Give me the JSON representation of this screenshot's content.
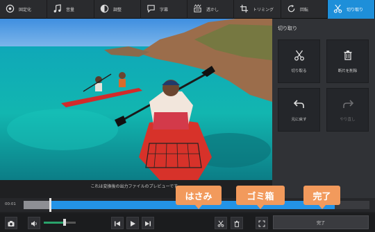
{
  "toolbar": {
    "items": [
      {
        "label": "固定化",
        "icon": "stabilize-icon"
      },
      {
        "label": "音量",
        "icon": "music-note-icon"
      },
      {
        "label": "調整",
        "icon": "adjust-icon"
      },
      {
        "label": "字幕",
        "icon": "subtitle-icon"
      },
      {
        "label": "透かし",
        "icon": "watermark-icon"
      },
      {
        "label": "トリミング",
        "icon": "crop-icon"
      },
      {
        "label": "回転",
        "icon": "rotate-icon"
      },
      {
        "label": "切り取り",
        "icon": "scissors-icon",
        "active": true
      }
    ]
  },
  "preview": {
    "caption": "これは変換後の出力ファイルのプレビューです。"
  },
  "panel": {
    "title": "切り取り",
    "buttons": [
      {
        "label": "切り取る",
        "icon": "scissors-icon"
      },
      {
        "label": "断片を削除",
        "icon": "trash-icon"
      },
      {
        "label": "元に戻す",
        "icon": "undo-icon"
      },
      {
        "label": "やり直し",
        "icon": "redo-icon",
        "disabled": true
      }
    ]
  },
  "timeline": {
    "current_time": "00:01"
  },
  "controls": {
    "done_label": "完了",
    "volume_level": 0.6
  },
  "callouts": {
    "scissors": "はさみ",
    "trash": "ゴミ箱",
    "done": "完了"
  },
  "colors": {
    "accent": "#1e8fd9",
    "callout": "#f29a5c",
    "timeline_blue": "#2393e6"
  }
}
